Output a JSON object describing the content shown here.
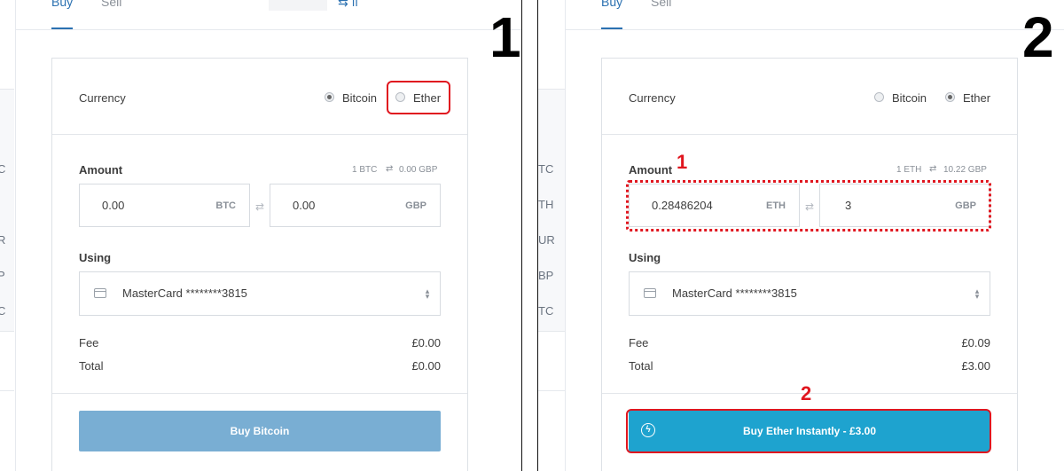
{
  "colors": {
    "accent": "#2b71b1",
    "highlight": "#e0161f",
    "button_primary": "#1ea3cf",
    "button_disabled": "#79aed3"
  },
  "panel1": {
    "step": "1",
    "tabs": [
      "Buy",
      "Sell"
    ],
    "sidebar_fragments": [
      "C",
      "l",
      "R",
      "P",
      "C"
    ],
    "currency_label": "Currency",
    "currency_options": [
      {
        "label": "Bitcoin",
        "selected": true
      },
      {
        "label": "Ether",
        "selected": false
      }
    ],
    "amount_label": "Amount",
    "rate_left": "1 BTC",
    "rate_right": "0.00 GBP",
    "crypto_value": "0.00",
    "crypto_unit": "BTC",
    "fiat_value": "0.00",
    "fiat_unit": "GBP",
    "using_label": "Using",
    "payment_method": "MasterCard ********3815",
    "fee_label": "Fee",
    "fee_value": "£0.00",
    "total_label": "Total",
    "total_value": "£0.00",
    "button_label": "Buy Bitcoin"
  },
  "panel2": {
    "step": "2",
    "tabs": [
      "Buy",
      "Sell"
    ],
    "sidebar_fragments": [
      "TC",
      "TH",
      "UR",
      "BP",
      "TC"
    ],
    "currency_label": "Currency",
    "currency_options": [
      {
        "label": "Bitcoin",
        "selected": false
      },
      {
        "label": "Ether",
        "selected": true
      }
    ],
    "amount_label": "Amount",
    "annotation_amount": "1",
    "rate_left": "1 ETH",
    "rate_right": "10.22 GBP",
    "crypto_value": "0.28486204",
    "crypto_unit": "ETH",
    "fiat_value": "3",
    "fiat_unit": "GBP",
    "using_label": "Using",
    "payment_method": "MasterCard ********3815",
    "fee_label": "Fee",
    "fee_value": "£0.09",
    "total_label": "Total",
    "total_value": "£3.00",
    "annotation_button": "2",
    "button_label": "Buy Ether Instantly - £3.00"
  }
}
